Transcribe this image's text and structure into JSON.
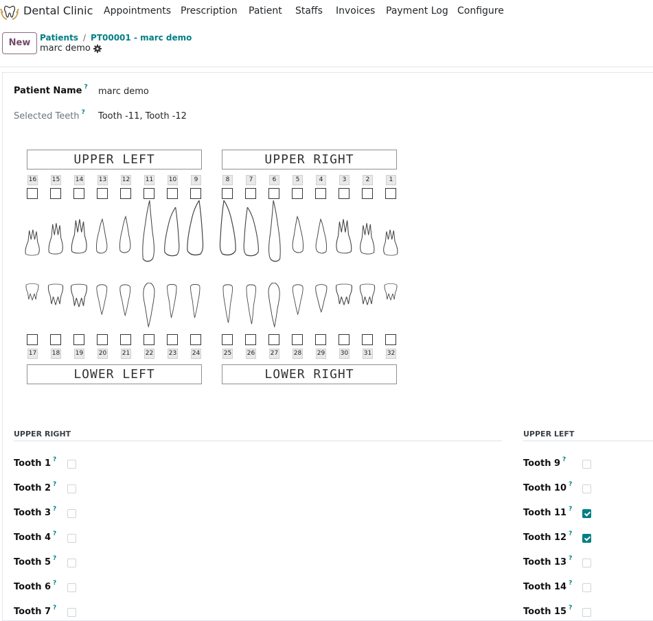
{
  "nav": {
    "app_name": "Dental Clinic",
    "menu": [
      "Appointments",
      "Prescription",
      "Patient",
      "Staffs",
      "Invoices",
      "Payment Log",
      "Configure"
    ]
  },
  "control": {
    "new_label": "New",
    "breadcrumb": [
      "Patients",
      "PT00001 - marc demo"
    ],
    "record_name": "marc demo"
  },
  "form": {
    "patient_name_label": "Patient Name",
    "patient_name_value": "marc demo",
    "selected_teeth_label": "Selected Teeth",
    "selected_teeth_value": "Tooth -11, Tooth -12",
    "help_mark": "?"
  },
  "chart": {
    "quadrants": {
      "upper_left": "UPPER LEFT",
      "upper_right": "UPPER RIGHT",
      "lower_left": "LOWER LEFT",
      "lower_right": "LOWER RIGHT"
    },
    "upper_numbers": [
      "16",
      "15",
      "14",
      "13",
      "12",
      "11",
      "10",
      "9",
      "8",
      "7",
      "6",
      "5",
      "4",
      "3",
      "2",
      "1"
    ],
    "lower_numbers": [
      "17",
      "18",
      "19",
      "20",
      "21",
      "22",
      "23",
      "24",
      "25",
      "26",
      "27",
      "28",
      "29",
      "30",
      "31",
      "32"
    ]
  },
  "sections": {
    "right_title": "UPPER RIGHT",
    "left_title": "UPPER LEFT",
    "right_teeth": [
      {
        "label": "Tooth 1",
        "checked": false
      },
      {
        "label": "Tooth 2",
        "checked": false
      },
      {
        "label": "Tooth 3",
        "checked": false
      },
      {
        "label": "Tooth 4",
        "checked": false
      },
      {
        "label": "Tooth 5",
        "checked": false
      },
      {
        "label": "Tooth 6",
        "checked": false
      },
      {
        "label": "Tooth 7",
        "checked": false
      }
    ],
    "left_teeth": [
      {
        "label": "Tooth 9",
        "checked": false
      },
      {
        "label": "Tooth 10",
        "checked": false
      },
      {
        "label": "Tooth 11",
        "checked": true
      },
      {
        "label": "Tooth 12",
        "checked": true
      },
      {
        "label": "Tooth 13",
        "checked": false
      },
      {
        "label": "Tooth 14",
        "checked": false
      },
      {
        "label": "Tooth 15",
        "checked": false
      }
    ]
  },
  "colors": {
    "accent": "#017e84",
    "brand": "#714b67"
  }
}
